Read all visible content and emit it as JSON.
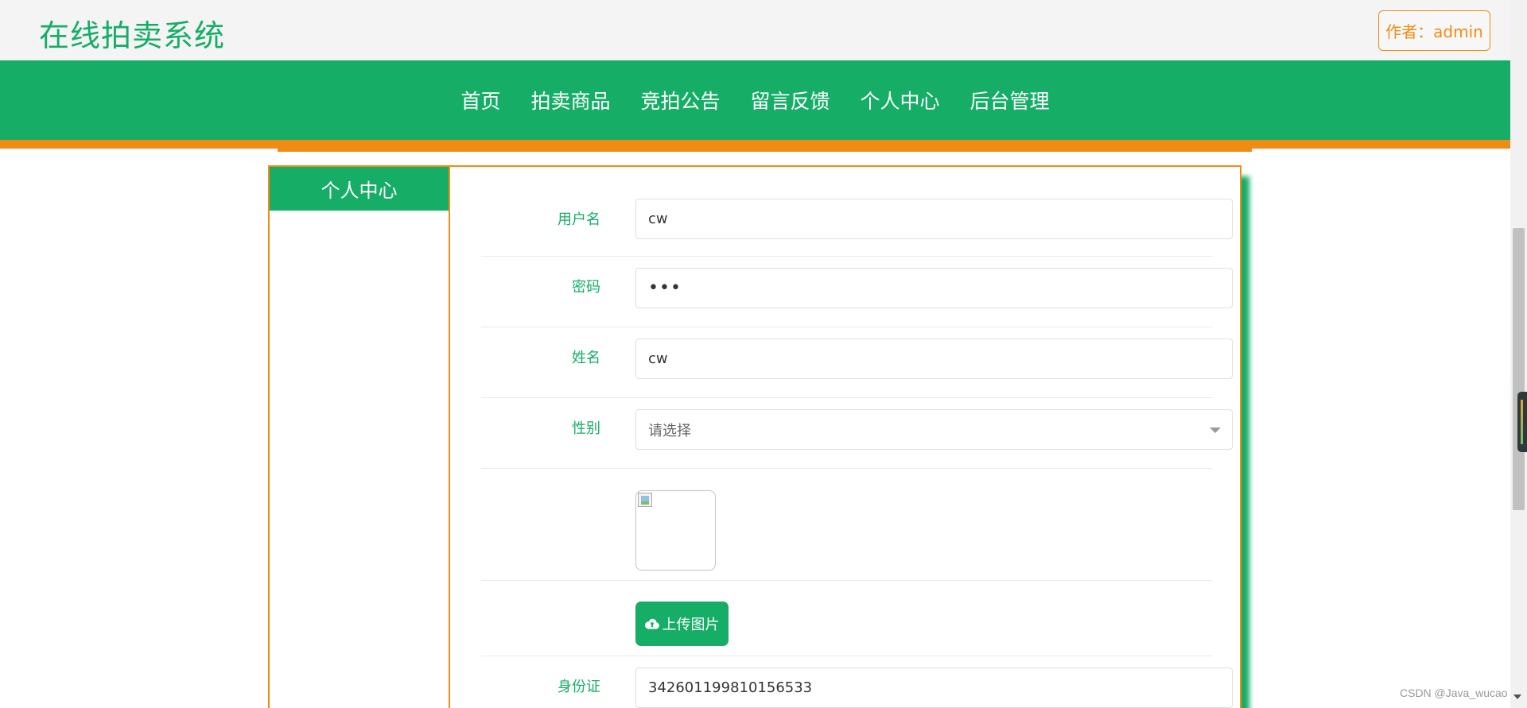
{
  "header": {
    "site_title": "在线拍卖系统",
    "author_label": "作者：admin"
  },
  "nav": {
    "items": [
      "首页",
      "拍卖商品",
      "竞拍公告",
      "留言反馈",
      "个人中心",
      "后台管理"
    ]
  },
  "sidebar": {
    "title": "个人中心"
  },
  "form": {
    "username": {
      "label": "用户名",
      "value": "cw"
    },
    "password": {
      "label": "密码",
      "value": "•••"
    },
    "name": {
      "label": "姓名",
      "value": "cw"
    },
    "gender": {
      "label": "性别",
      "placeholder": "请选择"
    },
    "upload_label": "上传图片",
    "id_card": {
      "label": "身份证",
      "value": "342601199810156533"
    }
  },
  "watermark": "CSDN @Java_wucao",
  "colors": {
    "brand_green": "#16ad67",
    "accent_orange": "#f08c14"
  },
  "icons": {
    "upload": "cloud-upload-icon",
    "select_arrow": "chevron-down-icon",
    "broken_image": "broken-image-icon"
  }
}
